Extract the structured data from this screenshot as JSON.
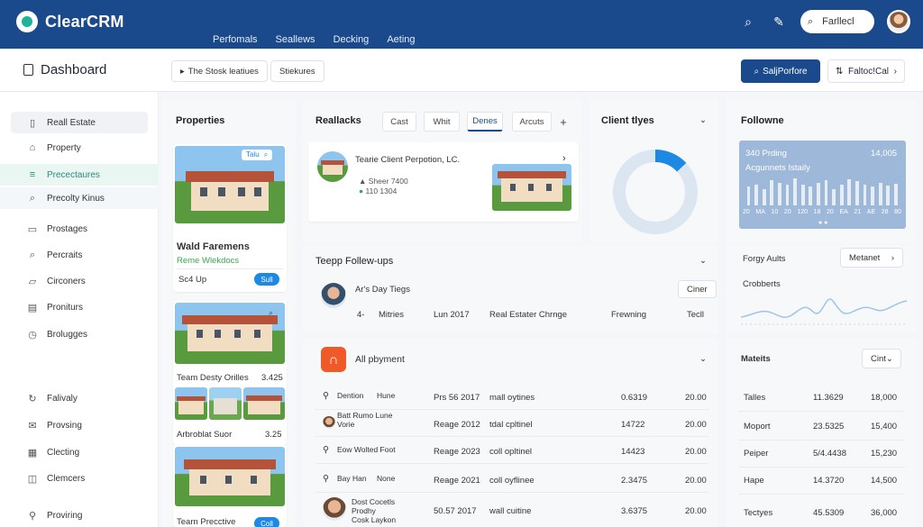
{
  "app": {
    "name": "ClearCRM"
  },
  "topnav": [
    "Perfomals",
    "Seallews",
    "Decking",
    "Aeting"
  ],
  "top_search": {
    "value": "Farllecl"
  },
  "header": {
    "title": "Dashboard",
    "chip1": "The Stosk leatiues",
    "chip2": "Stiekures",
    "primary": "SaljPorfore",
    "secondary": "Faltoc!Cal"
  },
  "sidebar": {
    "items": [
      {
        "label": "Reall Estate",
        "icon": "building-icon"
      },
      {
        "label": "Property",
        "icon": "house-icon"
      },
      {
        "label": "Precectaures",
        "icon": "list-icon"
      },
      {
        "label": "Precolty Kinus",
        "icon": "search-icon"
      },
      {
        "label": "Prostages",
        "icon": "document-icon"
      },
      {
        "label": "Percraits",
        "icon": "search-icon"
      },
      {
        "label": "Circoners",
        "icon": "folder-icon"
      },
      {
        "label": "Proniturs",
        "icon": "file-icon"
      },
      {
        "label": "Brolugges",
        "icon": "clock-icon"
      },
      {
        "label": "Falivaly",
        "icon": "refresh-icon"
      },
      {
        "label": "Provsing",
        "icon": "mail-icon"
      },
      {
        "label": "Clecting",
        "icon": "grid-icon"
      },
      {
        "label": "Clemcers",
        "icon": "chat-icon"
      },
      {
        "label": "Proviring",
        "icon": "pin-icon"
      }
    ]
  },
  "properties": {
    "title": "Properties",
    "card1": {
      "badge": "Talu",
      "name": "Wald Faremens",
      "sub": "Reme Wlekdocs",
      "price": "Sc4 Up",
      "btn": "Sull"
    },
    "card2": {
      "name": "Team Desty Orilles",
      "value": "3.425",
      "name2": "Arbroblat Suor",
      "value2": "3.25"
    },
    "card3": {
      "name": "Tearn Precctive",
      "btn": "Coll"
    }
  },
  "reallacks": {
    "title": "Reallacks",
    "tabs": [
      "Cast",
      "Whit",
      "Denes",
      "Arcuts"
    ],
    "selected_tab": "Denes",
    "client": {
      "name": "Tearie Client Perpotion, LC.",
      "line1": "Sheer 7400",
      "line2": "110 1304"
    }
  },
  "client_types": {
    "title": "Client tlyes",
    "donut_fraction": 0.13
  },
  "followne": {
    "title": "Followne",
    "card_title": "340 Prding",
    "card_value": "14,005",
    "card_sub": "Acgunnets Istaily",
    "bars": [
      0.45,
      0.5,
      0.4,
      0.6,
      0.55,
      0.5,
      0.65,
      0.5,
      0.45,
      0.55,
      0.6,
      0.4,
      0.5,
      0.62,
      0.58,
      0.5,
      0.45,
      0.55,
      0.48,
      0.52
    ],
    "axis": [
      "20",
      "MA",
      "10",
      "20",
      "120",
      "18",
      "20",
      "EA",
      "21",
      "AE",
      "28",
      "80"
    ]
  },
  "follow_ups": {
    "title": "Teepp Follew-ups",
    "person": "Ar's Day Tiegs",
    "btn": "Ciner",
    "cols": [
      "4-",
      "Mitries",
      "Lun 2017",
      "Real Estater Chrnge",
      "Frewning",
      "Tecll"
    ]
  },
  "forgy": {
    "title": "Forgy Aults",
    "btn": "Metanet",
    "sub": "Crobberts"
  },
  "payment": {
    "title": "All pbyment",
    "rows": [
      {
        "a": "Dention",
        "b": "Hune",
        "c": "Prs 56 2017",
        "d": "mall oytines",
        "e": "0.6319",
        "f": "20.00"
      },
      {
        "a": "Batt Rumo Lune",
        "a2": "Vorie",
        "b": "",
        "c": "Reage 2012",
        "d": "tdal cpltinel",
        "e": "14722",
        "f": "20.00"
      },
      {
        "a": "Eow Wolted Foot",
        "a2": "",
        "b": "",
        "c": "Reage 2023",
        "d": "coll opltinel",
        "e": "14423",
        "f": "20.00"
      },
      {
        "a": "Bay Han",
        "b": "None",
        "c": "Reage 2021",
        "d": "coll oyflinee",
        "e": "2.3475",
        "f": "20.00"
      },
      {
        "a": "Dost Cocetls",
        "a2": "Prodhy",
        "a3": "Cosk Laykon",
        "b": "",
        "c": "50.57 2017",
        "d": "wall cuitine",
        "e": "3.6375",
        "f": "20.00"
      }
    ]
  },
  "mateits": {
    "title": "Mateits",
    "btn": "Cint",
    "rows": [
      {
        "name": "Talles",
        "v1": "11.3629",
        "v2": "18,000"
      },
      {
        "name": "Moport",
        "v1": "23.5325",
        "v2": "15,400"
      },
      {
        "name": "Peiper",
        "v1": "5/4.4438",
        "v2": "15,230"
      },
      {
        "name": "Hape",
        "v1": "14.3720",
        "v2": "14,500"
      },
      {
        "name": "Tectyes",
        "v1": "45.5309",
        "v2": "36,000"
      }
    ]
  },
  "colors": {
    "brand": "#1b4a8c",
    "accent": "#1fb39a",
    "donut": "#1e88e5"
  }
}
